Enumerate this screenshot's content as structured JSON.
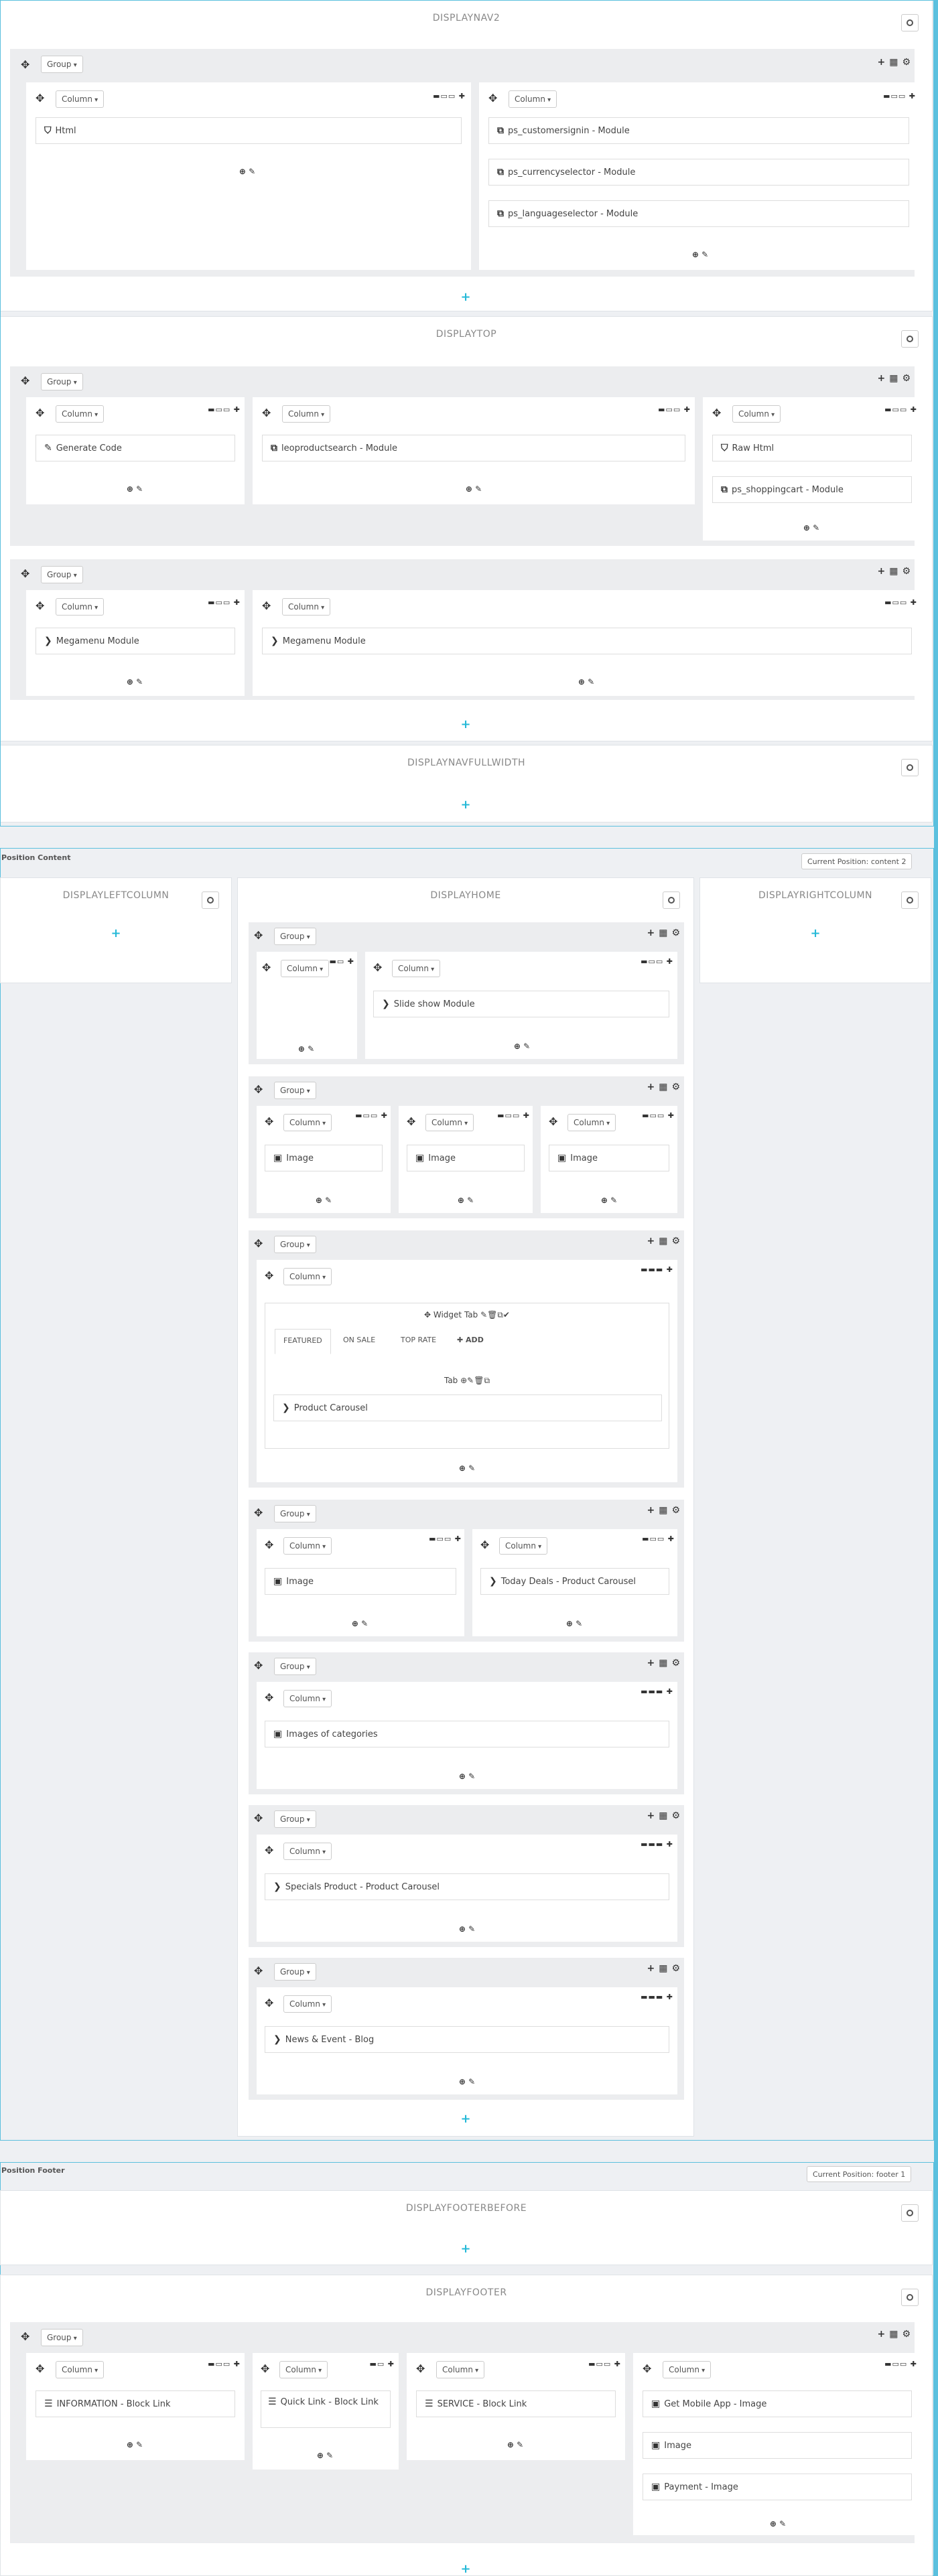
{
  "labels": {
    "group": "Group",
    "column": "Column",
    "add": "+"
  },
  "hooks": {
    "displaynav2": "DISPLAYNAV2",
    "displaytop": "DISPLAYTOP",
    "displaynavfullwidth": "DISPLAYNAVFULLWIDTH",
    "displayleftcolumn": "DISPLAYLEFTCOLUMN",
    "displayhome": "DISPLAYHOME",
    "displayrightcolumn": "DISPLAYRIGHTCOLUMN",
    "displayfooterbefore": "DISPLAYFOOTERBEFORE",
    "displayfooter": "DISPLAYFOOTER"
  },
  "positions": {
    "content_label": "Position Content",
    "content_select": "Current Position: content 2",
    "footer_label": "Position Footer",
    "footer_select": "Current Position: footer 1"
  },
  "widgets": {
    "nav_html": "Html",
    "nav_signin": "ps_customersignin - Module",
    "nav_currency": "ps_currencyselector - Module",
    "nav_language": "ps_languageselector - Module",
    "top_generate": "Generate Code",
    "top_search": "leoproductsearch - Module",
    "top_rawhtml": "Raw Html",
    "top_cart": "ps_shoppingcart - Module",
    "top_mega1": "Megamenu Module",
    "top_mega2": "Megamenu Module",
    "home_slideshow": "Slide show Module",
    "home_image1": "Image",
    "home_image2": "Image",
    "home_image3": "Image",
    "home_widgettab": "Widget Tab",
    "home_tab_featured": "FEATURED",
    "home_tab_onsale": "ON SALE",
    "home_tab_toprate": "TOP RATE",
    "home_tab_add": "ADD",
    "home_tab_label": "Tab",
    "home_product_carousel": "Product Carousel",
    "home_image4": "Image",
    "home_today_deals": "Today Deals - Product Carousel",
    "home_images_categories": "Images of categories",
    "home_specials": "Specials Product - Product Carousel",
    "home_news": "News & Event - Blog",
    "foot_information": "INFORMATION - Block Link",
    "foot_quicklink": "Quick Link - Block Link",
    "foot_service": "SERVICE - Block Link",
    "foot_mobileapp": "Get Mobile App - Image",
    "foot_image": "Image",
    "foot_payment": "Payment - Image"
  },
  "icons": {
    "move": "move-arrows-icon",
    "add_column": "plus-icon",
    "grid": "grid-icon",
    "settings": "gear-icon",
    "edit": "pencil-icon",
    "html": "html5-icon",
    "module": "copy-icon",
    "image": "image-icon",
    "chevron": "chevron-right-icon",
    "list": "list-icon"
  },
  "colors": {
    "accent": "#25b9d7",
    "border": "#5bc0de"
  }
}
